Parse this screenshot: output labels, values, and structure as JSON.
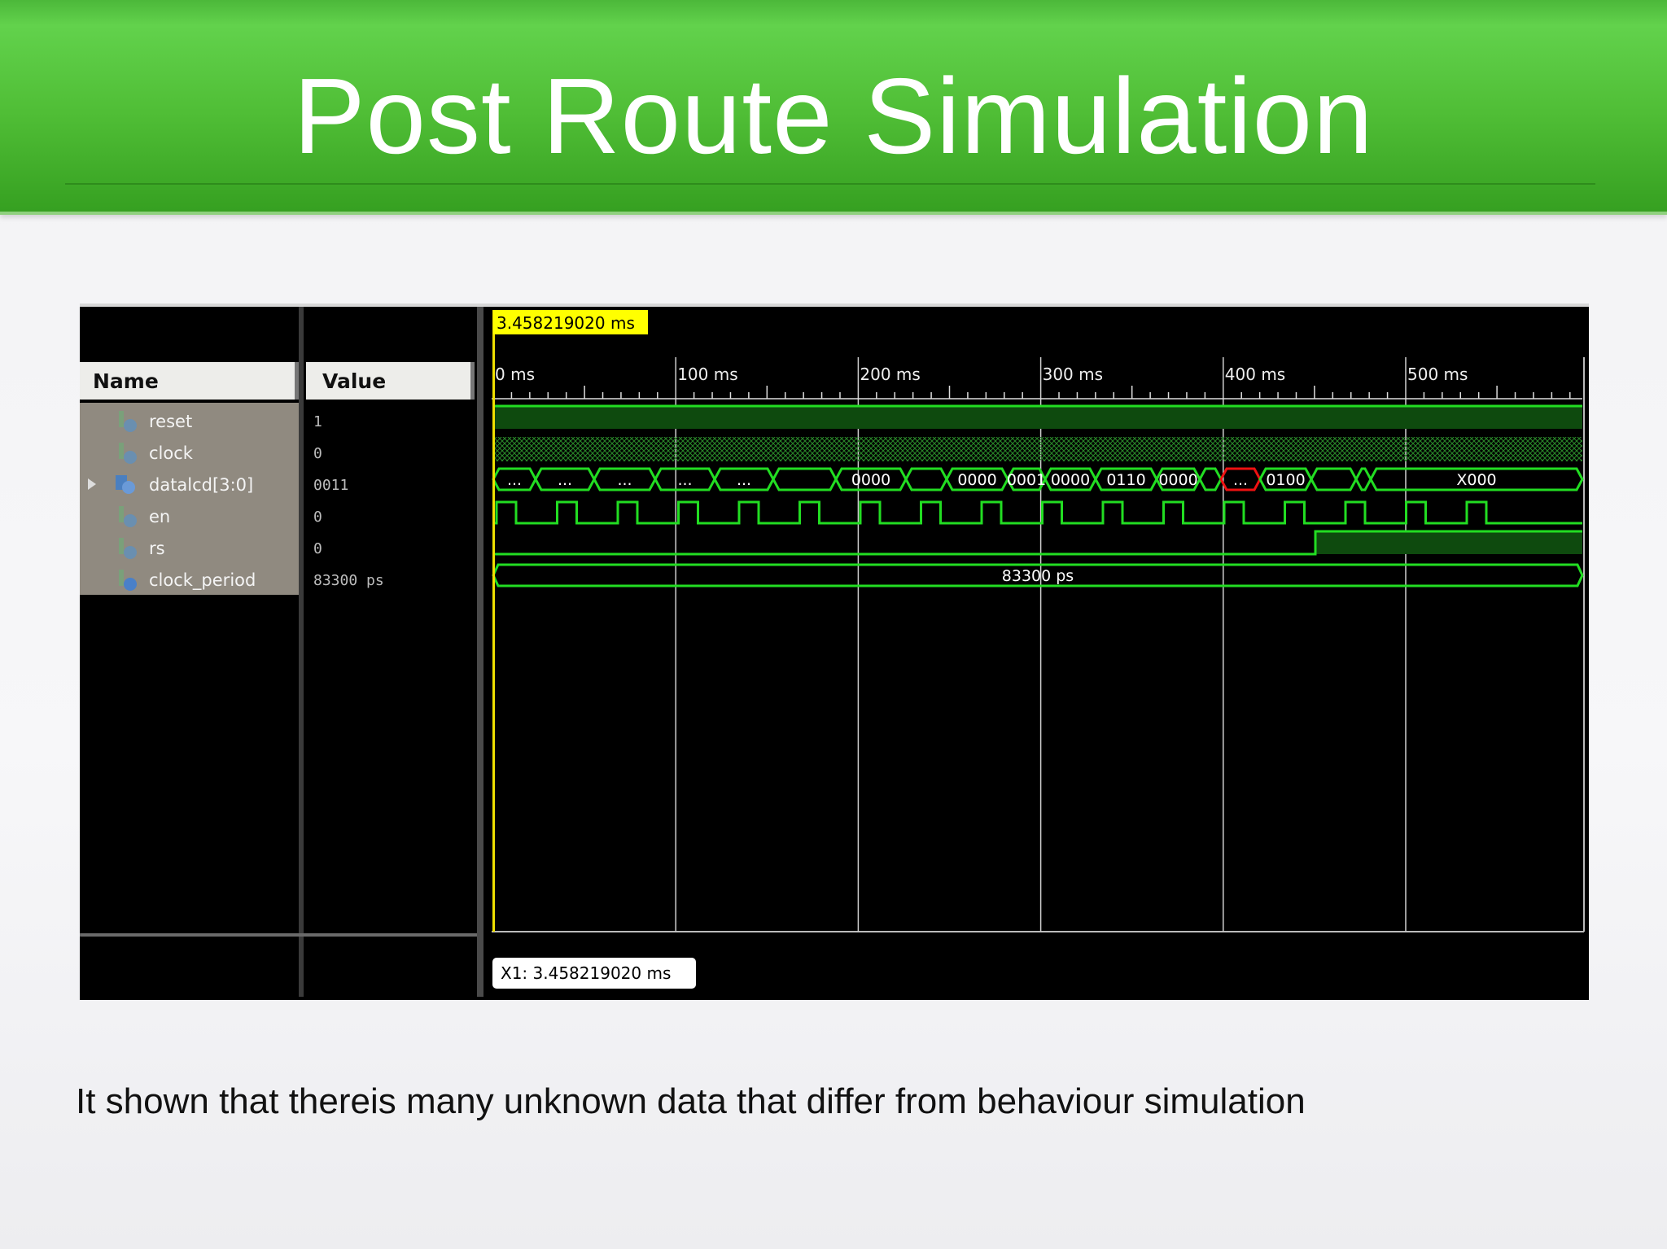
{
  "slide": {
    "title": "Post Route Simulation",
    "caption": "It shown that thereis many unknown data that differ from behaviour simulation"
  },
  "sim": {
    "columns": {
      "name": "Name",
      "value": "Value"
    },
    "cursor_label": "3.458219020 ms",
    "cursor_readout": "X1: 3.458219020 ms",
    "time_ticks": [
      "0 ms",
      "100 ms",
      "200 ms",
      "300 ms",
      "400 ms",
      "500 ms"
    ],
    "signals": [
      {
        "name": "reset",
        "value": "1",
        "icon": "bit-signal-icon"
      },
      {
        "name": "clock",
        "value": "0",
        "icon": "bit-signal-icon"
      },
      {
        "name": "datalcd[3:0]",
        "value": "0011",
        "icon": "bus-signal-icon",
        "expandable": true
      },
      {
        "name": "en",
        "value": "0",
        "icon": "bit-signal-icon"
      },
      {
        "name": "rs",
        "value": "0",
        "icon": "bit-signal-icon"
      },
      {
        "name": "clock_period",
        "value": "83300 ps",
        "icon": "constant-signal-icon"
      }
    ],
    "bus_labels": [
      "...",
      "...",
      "...",
      "...",
      "...",
      "0000",
      "0000",
      "0001",
      "0000",
      "0110",
      "0000",
      "...",
      "0100",
      "X000"
    ],
    "clock_period_label": "83300 ps",
    "colors": {
      "wave": "#22dd22",
      "bus_unknown": "#ee1111",
      "cursor": "#f0e000",
      "cursor_label_bg": "#ffff00",
      "name_panel_bg": "#908a80"
    }
  }
}
